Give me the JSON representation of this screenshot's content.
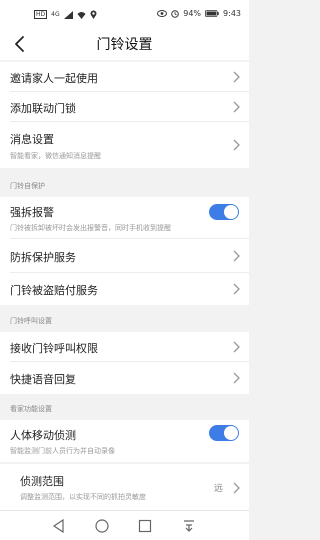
{
  "status_bar": {
    "left_badges": [
      "HD",
      "4G"
    ],
    "battery": "94%",
    "time": "9:43"
  },
  "header": {
    "title": "门铃设置"
  },
  "rows": [
    {
      "label": "邀请家人一起使用"
    },
    {
      "label": "添加联动门锁"
    },
    {
      "label": "消息设置",
      "sub": "智能看家，微信通知消息提醒"
    }
  ],
  "sections": [
    {
      "title": "门铃自保护"
    },
    {
      "title": "门铃呼叫设置"
    },
    {
      "title": "看家功能设置"
    }
  ],
  "protect": {
    "alarm": {
      "label": "强拆报警",
      "sub": "门铃被拆卸被坏时会发出报警音，同时手机收到提醒",
      "enabled": true
    },
    "service": {
      "label": "防拆保护服务"
    },
    "insurance": {
      "label": "门铃被盗赔付服务"
    }
  },
  "call": {
    "permission": {
      "label": "接收门铃呼叫权限"
    },
    "quick_reply": {
      "label": "快捷语音回复"
    }
  },
  "home": {
    "motion": {
      "label": "人体移动侦测",
      "sub": "智能监测门前人员行为并自动录像",
      "enabled": true
    },
    "range": {
      "label": "侦测范围",
      "sub": "调整监测范围，以实现不同的抓拍灵敏度",
      "value": "远"
    }
  },
  "colors": {
    "accent": "#3f7de6"
  },
  "icons": [
    "back-arrow-icon",
    "chevron-right-icon",
    "nav-back-icon",
    "nav-home-icon",
    "nav-recent-icon",
    "nav-menu-icon"
  ]
}
